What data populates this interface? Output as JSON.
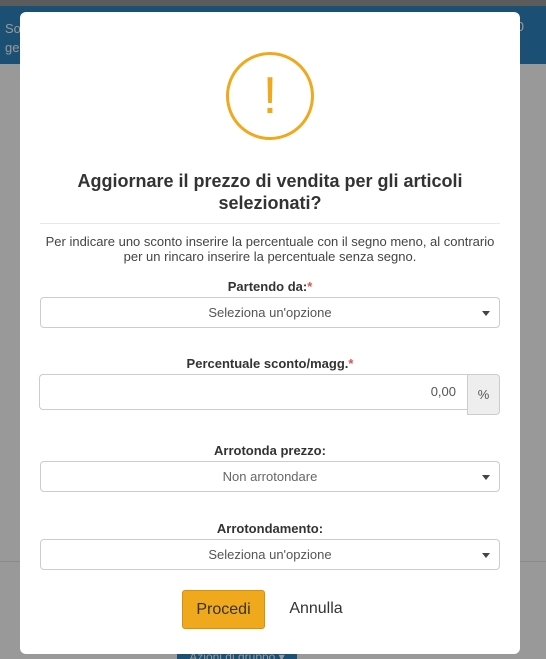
{
  "background": {
    "banner_left_line1": "So",
    "banner_left_line2": "ge",
    "banner_right": "0",
    "actions_button": "Azioni di gruppo ▾"
  },
  "modal": {
    "icon": "exclamation-icon",
    "icon_glyph": "!",
    "title": "Aggiornare il prezzo di vendita per gli articoli selezionati?",
    "description": "Per indicare uno sconto inserire la percentuale con il segno meno, al contrario per un rincaro inserire la percentuale senza segno.",
    "fields": {
      "starting_from": {
        "label": "Partendo da:",
        "required_mark": "*",
        "value": "Seleziona un'opzione"
      },
      "percentage": {
        "label": "Percentuale sconto/magg.",
        "required_mark": "*",
        "value": "0,00",
        "suffix": "%"
      },
      "round_price": {
        "label": "Arrotonda prezzo:",
        "value": "Non arrotondare"
      },
      "rounding": {
        "label": "Arrotondamento:",
        "value": "Seleziona un'opzione"
      }
    },
    "buttons": {
      "proceed": "Procedi",
      "cancel": "Annulla"
    }
  },
  "colors": {
    "accent": "#f0a81c",
    "banner": "#2e86c1",
    "required": "#d9534f"
  }
}
